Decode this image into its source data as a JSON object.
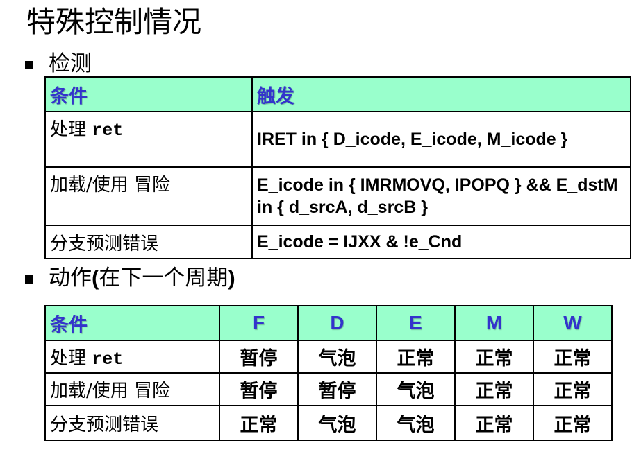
{
  "title": "特殊控制情况",
  "detect": {
    "heading": "检测",
    "col_condition": "条件",
    "col_trigger": "触发",
    "rows": [
      {
        "cond_text": "处理 ",
        "cond_code": "ret",
        "trigger": "IRET in { D_icode, E_icode, M_icode }"
      },
      {
        "cond_text": "加载/使用 冒险",
        "cond_code": "",
        "trigger": "E_icode in { IMRMOVQ, IPOPQ } && E_dstM in { d_srcA, d_srcB }"
      },
      {
        "cond_text": "分支预测错误",
        "cond_code": "",
        "trigger": "E_icode = IJXX & !e_Cnd"
      }
    ]
  },
  "action": {
    "heading_pre": "动作",
    "heading_paren": "(",
    "heading_mid": "在下一个周期",
    "heading_close": ")",
    "col_condition": "条件",
    "stages": [
      "F",
      "D",
      "E",
      "M",
      "W"
    ],
    "rows": [
      {
        "cond_text": "处理 ",
        "cond_code": "ret",
        "cells": [
          "暂停",
          "气泡",
          "正常",
          "正常",
          "正常"
        ]
      },
      {
        "cond_text": "加载/使用 冒险",
        "cond_code": "",
        "cells": [
          "暂停",
          "暂停",
          "气泡",
          "正常",
          "正常"
        ]
      },
      {
        "cond_text": "分支预测错误",
        "cond_code": "",
        "cells": [
          "正常",
          "气泡",
          "气泡",
          "正常",
          "正常"
        ]
      }
    ]
  },
  "colors": {
    "header_bg": "#99ffcc",
    "header_text": "#3333cc"
  }
}
